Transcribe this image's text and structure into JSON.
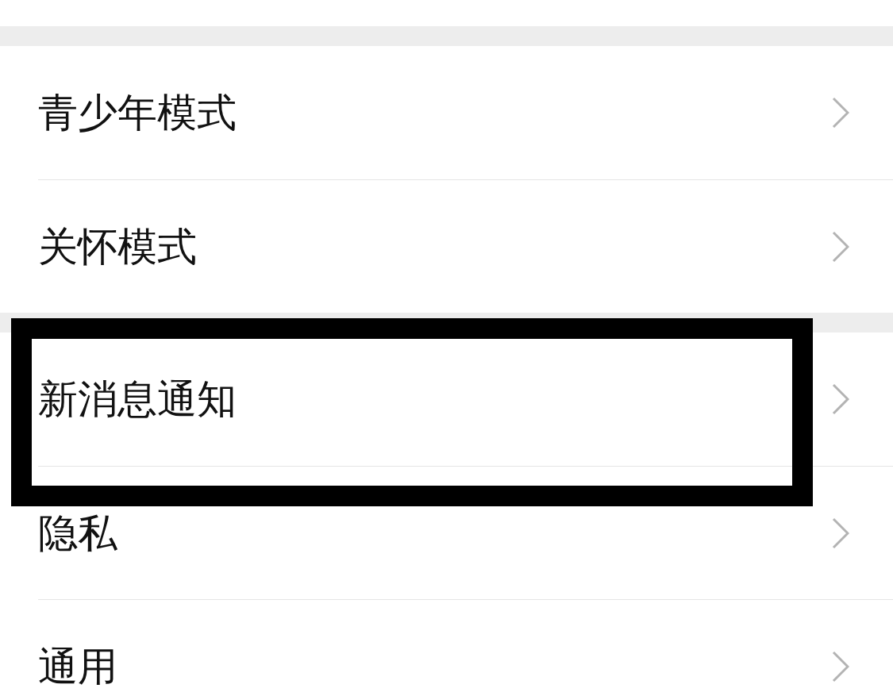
{
  "sections": [
    {
      "items": [
        {
          "label": "青少年模式",
          "highlighted": false
        },
        {
          "label": "关怀模式",
          "highlighted": false
        }
      ]
    },
    {
      "items": [
        {
          "label": "新消息通知",
          "highlighted": true
        },
        {
          "label": "隐私",
          "highlighted": false
        },
        {
          "label": "通用",
          "highlighted": false
        }
      ]
    }
  ]
}
